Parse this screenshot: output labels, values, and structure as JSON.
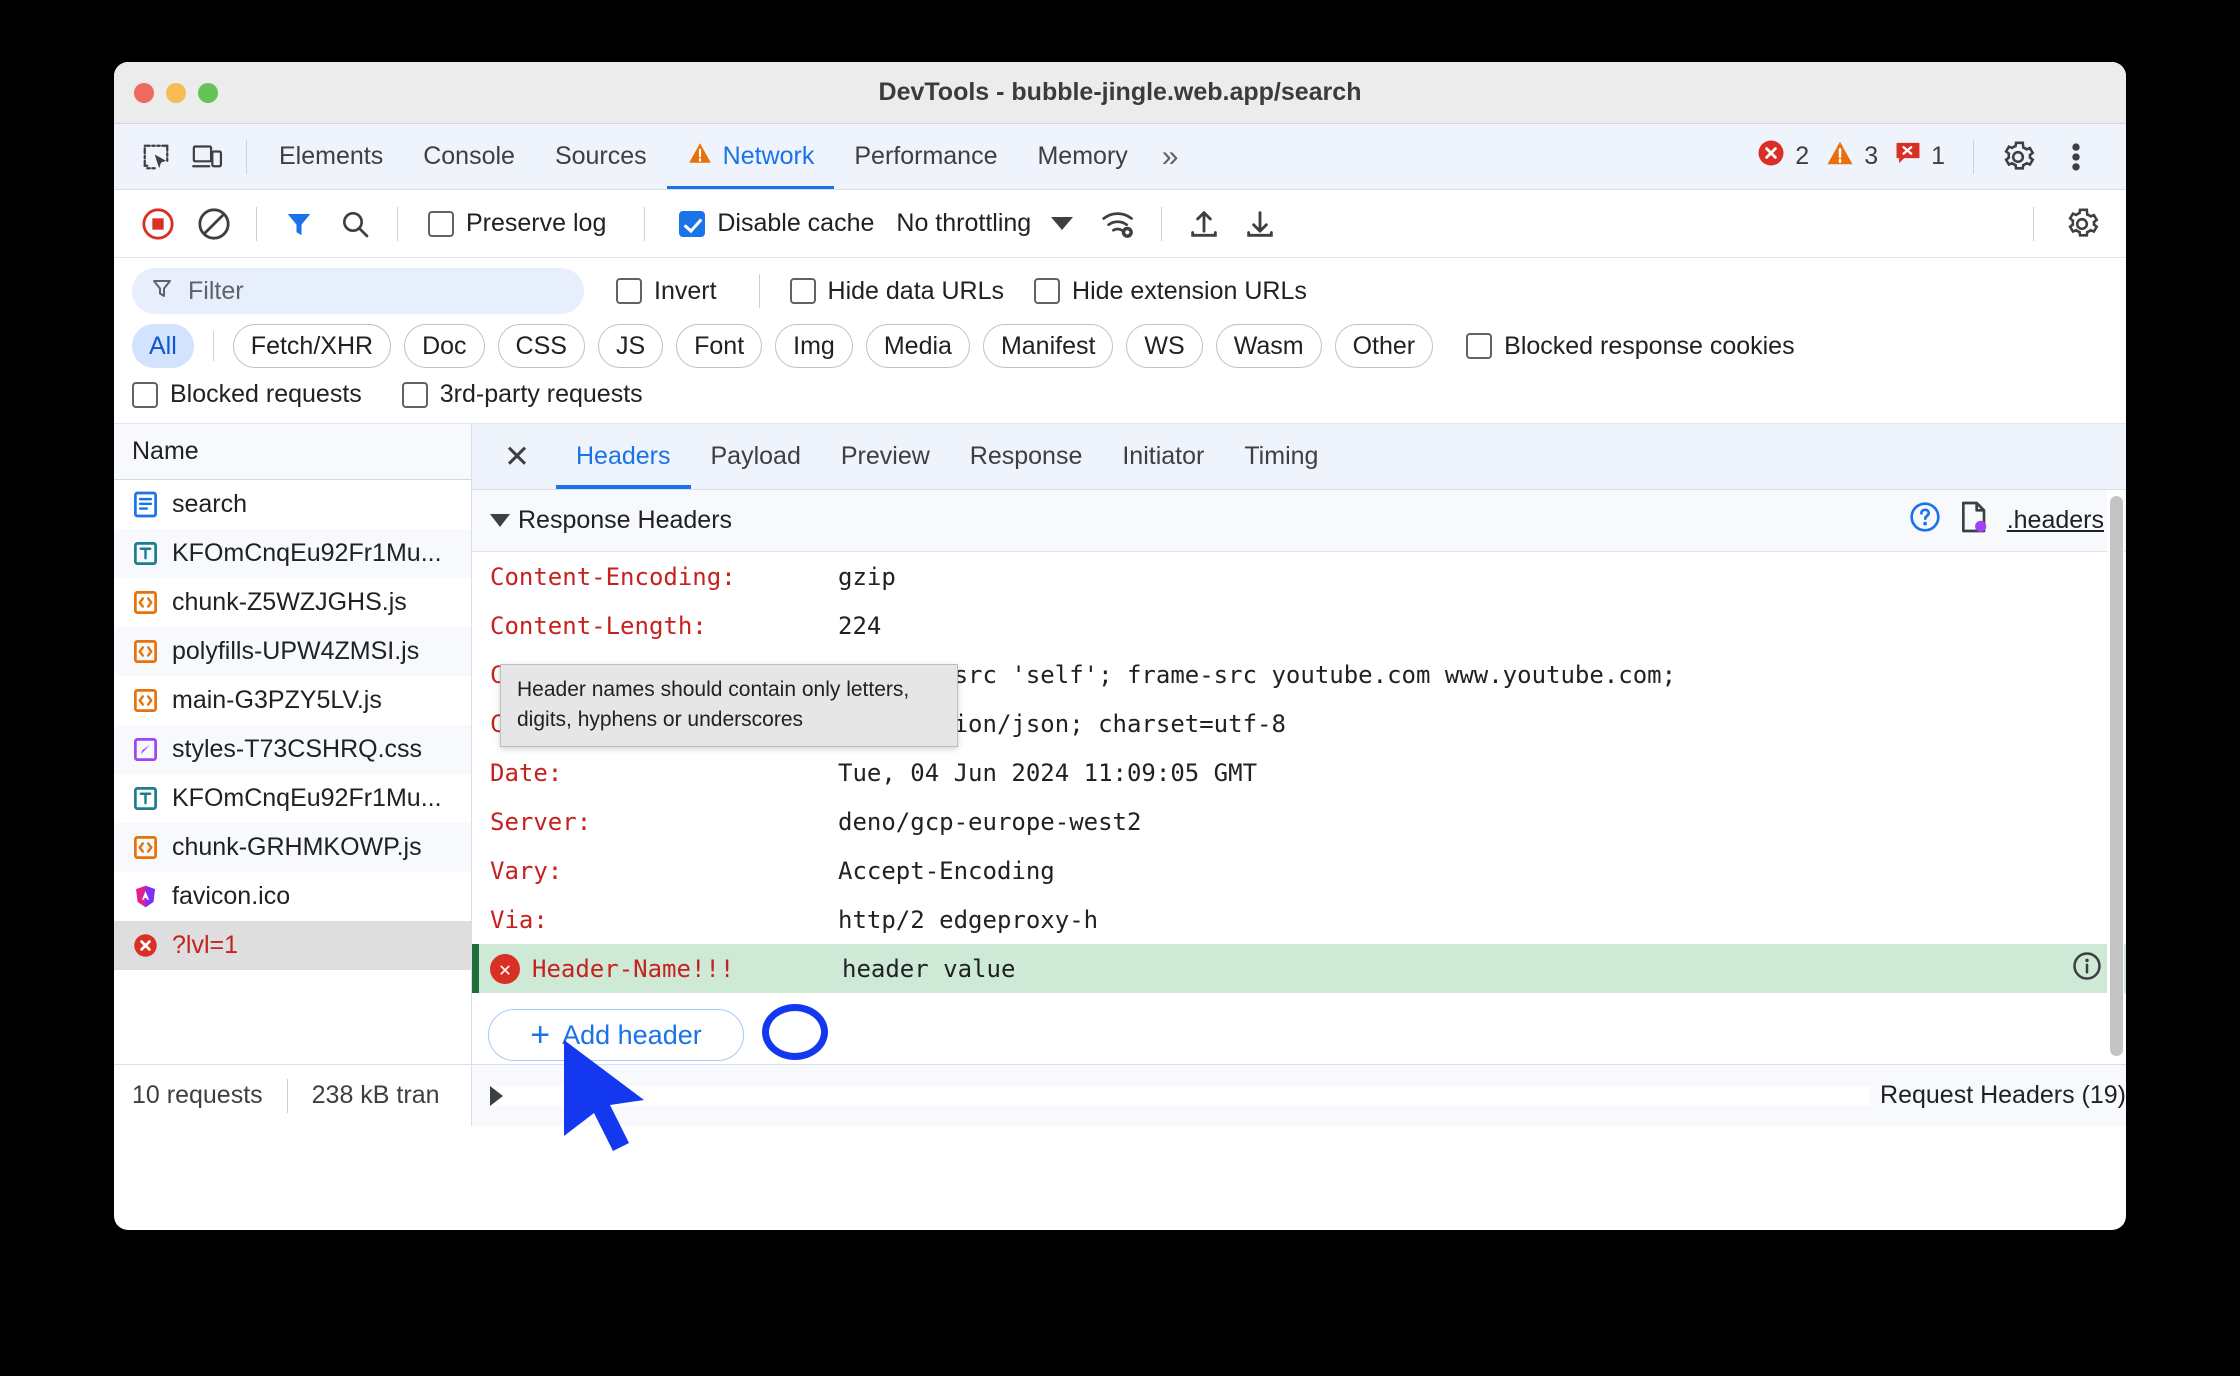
{
  "window": {
    "title": "DevTools - bubble-jingle.web.app/search"
  },
  "tabs": {
    "items": [
      {
        "label": "Elements",
        "active": false,
        "warn": false
      },
      {
        "label": "Console",
        "active": false,
        "warn": false
      },
      {
        "label": "Sources",
        "active": false,
        "warn": false
      },
      {
        "label": "Network",
        "active": true,
        "warn": true
      },
      {
        "label": "Performance",
        "active": false,
        "warn": false
      },
      {
        "label": "Memory",
        "active": false,
        "warn": false
      }
    ],
    "more": "»",
    "counters": {
      "errors": "2",
      "warnings": "3",
      "issues": "1"
    }
  },
  "toolbar": {
    "record_icon": "record-icon",
    "clear_icon": "clear-icon",
    "filter_icon": "filter-icon",
    "search_icon": "search-icon",
    "preserve_log": {
      "label": "Preserve log",
      "checked": false
    },
    "disable_cache": {
      "label": "Disable cache",
      "checked": true
    },
    "throttling": "No throttling",
    "wifi_icon": "network-conditions-icon",
    "import_icon": "import-har-icon",
    "export_icon": "export-har-icon",
    "settings_icon": "gear-icon"
  },
  "filter": {
    "placeholder": "Filter",
    "value": "",
    "invert": {
      "label": "Invert",
      "checked": false
    },
    "hide_data_urls": {
      "label": "Hide data URLs",
      "checked": false
    },
    "hide_extension_urls": {
      "label": "Hide extension URLs",
      "checked": false
    },
    "types": [
      {
        "label": "All",
        "active": true
      },
      {
        "label": "Fetch/XHR",
        "active": false
      },
      {
        "label": "Doc",
        "active": false
      },
      {
        "label": "CSS",
        "active": false
      },
      {
        "label": "JS",
        "active": false
      },
      {
        "label": "Font",
        "active": false
      },
      {
        "label": "Img",
        "active": false
      },
      {
        "label": "Media",
        "active": false
      },
      {
        "label": "Manifest",
        "active": false
      },
      {
        "label": "WS",
        "active": false
      },
      {
        "label": "Wasm",
        "active": false
      },
      {
        "label": "Other",
        "active": false
      }
    ],
    "blocked_response_cookies": {
      "label": "Blocked response cookies",
      "checked": false
    },
    "blocked_requests": {
      "label": "Blocked requests",
      "checked": false
    },
    "third_party_requests": {
      "label": "3rd-party requests",
      "checked": false
    }
  },
  "requests": {
    "column_header": "Name",
    "items": [
      {
        "name": "search",
        "icon": "document-icon",
        "selected": false,
        "error": false
      },
      {
        "name": "KFOmCnqEu92Fr1Mu...",
        "icon": "font-icon",
        "selected": false,
        "error": false
      },
      {
        "name": "chunk-Z5WZJGHS.js",
        "icon": "script-icon",
        "selected": false,
        "error": false
      },
      {
        "name": "polyfills-UPW4ZMSI.js",
        "icon": "script-icon",
        "selected": false,
        "error": false
      },
      {
        "name": "main-G3PZY5LV.js",
        "icon": "script-icon",
        "selected": false,
        "error": false
      },
      {
        "name": "styles-T73CSHRQ.css",
        "icon": "stylesheet-icon",
        "selected": false,
        "error": false
      },
      {
        "name": "KFOmCnqEu92Fr1Mu...",
        "icon": "font-icon",
        "selected": false,
        "error": false
      },
      {
        "name": "chunk-GRHMKOWP.js",
        "icon": "script-icon",
        "selected": false,
        "error": false
      },
      {
        "name": "favicon.ico",
        "icon": "image-icon",
        "selected": false,
        "error": false
      },
      {
        "name": "?lvl=1",
        "icon": "error-icon",
        "selected": true,
        "error": true
      }
    ]
  },
  "detail": {
    "close_label": "✕",
    "tabs": [
      {
        "label": "Headers",
        "active": true
      },
      {
        "label": "Payload",
        "active": false
      },
      {
        "label": "Preview",
        "active": false
      },
      {
        "label": "Response",
        "active": false
      },
      {
        "label": "Initiator",
        "active": false
      },
      {
        "label": "Timing",
        "active": false
      }
    ],
    "response_section": {
      "title": "Response Headers",
      "help_icon": "help-icon",
      "file_icon": "headers-file-icon",
      "link": ".headers"
    },
    "headers": [
      {
        "name": "Content-Encoding:",
        "value": "gzip",
        "error": false
      },
      {
        "name": "Content-Length:",
        "value": "224",
        "error": false
      },
      {
        "name": "Content-Security-Policy:",
        "value": "default-src 'self'; frame-src youtube.com www.youtube.com;",
        "error": false
      },
      {
        "name": "Content-Type:",
        "value": "application/json; charset=utf-8",
        "error": false
      },
      {
        "name": "Date:",
        "value": "Tue, 04 Jun 2024 11:09:05 GMT",
        "error": false
      },
      {
        "name": "Server:",
        "value": "deno/gcp-europe-west2",
        "error": false
      },
      {
        "name": "Vary:",
        "value": "Accept-Encoding",
        "error": false
      },
      {
        "name": "Via:",
        "value": "http/2 edgeproxy-h",
        "error": false
      },
      {
        "name": "Header-Name!!!",
        "value": "header value",
        "error": true
      }
    ],
    "add_header": {
      "plus": "+",
      "label": "Add header"
    },
    "tooltip": "Header names should contain only letters, digits, hyphens or underscores",
    "request_section": {
      "title": "Request Headers (19)"
    }
  },
  "footer": {
    "requests_count": "10 requests",
    "transferred": "238 kB tran"
  },
  "colors": {
    "accent": "#1a73e8",
    "error": "#d93025",
    "warning": "#e8710a",
    "header_name": "#c5221f",
    "highlight_row": "#ceead6",
    "annotation": "#1338f0"
  }
}
